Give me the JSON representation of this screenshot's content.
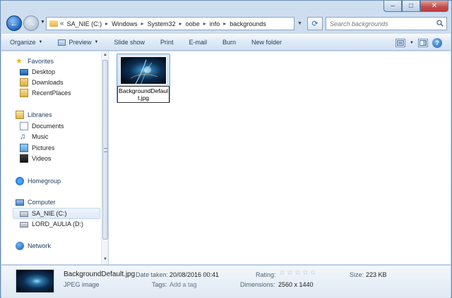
{
  "window": {
    "caption": {
      "minimize": "–",
      "maximize": "□",
      "close": "✕"
    }
  },
  "address": {
    "overflow": "«",
    "crumbs": [
      "SA_NIE (C:)",
      "Windows",
      "System32",
      "oobe",
      "info",
      "backgrounds"
    ]
  },
  "search": {
    "placeholder": "Search backgrounds"
  },
  "toolbar": {
    "organize": "Organize",
    "preview": "Preview",
    "slideshow": "Slide show",
    "print": "Print",
    "email": "E-mail",
    "burn": "Burn",
    "new_folder": "New folder",
    "help": "?"
  },
  "nav": {
    "favorites": "Favorites",
    "desktop": "Desktop",
    "downloads": "Downloads",
    "recent": "RecentPlaces",
    "libraries": "Libraries",
    "documents": "Documents",
    "music": "Music",
    "pictures": "Pictures",
    "videos": "Videos",
    "homegroup": "Homegroup",
    "computer": "Computer",
    "drive_c": "SA_NIE (C:)",
    "drive_d": "LORD_AULIA (D:)",
    "network": "Network"
  },
  "content": {
    "file_rename_value": "BackgroundDefault.jpg"
  },
  "details": {
    "file_name": "BackgroundDefault.jpg",
    "file_type": "JPEG image",
    "date_taken_label": "Date taken:",
    "date_taken": "20/08/2016 00:41",
    "tags_label": "Tags:",
    "tags_placeholder": "Add a tag",
    "rating_label": "Rating:",
    "rating": 0,
    "dimensions_label": "Dimensions:",
    "dimensions": "2560 x 1440",
    "size_label": "Size:",
    "size": "223 KB"
  },
  "colors": {
    "accent": "#1d66c4",
    "selection": "#c1dcfc"
  }
}
